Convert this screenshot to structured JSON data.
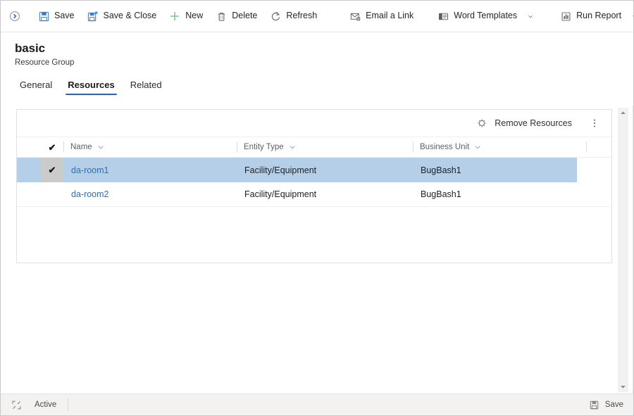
{
  "commandbar": {
    "back_icon": "chevron-right-circle-icon",
    "buttons": [
      {
        "id": "save",
        "label": "Save",
        "icon": "floppy-disk-icon",
        "caret": false
      },
      {
        "id": "save-and-close",
        "label": "Save & Close",
        "icon": "save-close-icon",
        "caret": false
      },
      {
        "id": "new",
        "label": "New",
        "icon": "plus-icon",
        "caret": false
      },
      {
        "id": "delete",
        "label": "Delete",
        "icon": "trash-icon",
        "caret": false
      },
      {
        "id": "refresh",
        "label": "Refresh",
        "icon": "refresh-icon",
        "caret": false
      },
      {
        "id": "email-a-link",
        "label": "Email a Link",
        "icon": "email-link-icon",
        "caret": false
      },
      {
        "id": "word-templates",
        "label": "Word Templates",
        "icon": "word-document-icon",
        "caret": true
      },
      {
        "id": "run-report",
        "label": "Run Report",
        "icon": "bar-chart-icon",
        "caret": true
      }
    ]
  },
  "header": {
    "title": "basic",
    "subtitle": "Resource Group"
  },
  "tabs": [
    {
      "id": "general",
      "label": "General",
      "active": false
    },
    {
      "id": "resources",
      "label": "Resources",
      "active": true
    },
    {
      "id": "related",
      "label": "Related",
      "active": false
    }
  ],
  "grid": {
    "commands": {
      "remove_resources_label": "Remove Resources",
      "remove_resources_icon": "remove-link-icon",
      "overflow_icon": "more-vertical-icon"
    },
    "select_all_icon": "checkmark-icon",
    "columns": [
      {
        "id": "name",
        "label": "Name",
        "sort_icon": "chevron-down-icon"
      },
      {
        "id": "entity-type",
        "label": "Entity Type",
        "sort_icon": "chevron-down-icon"
      },
      {
        "id": "business-unit",
        "label": "Business Unit",
        "sort_icon": "chevron-down-icon"
      }
    ],
    "rows": [
      {
        "selected": true,
        "check_icon": "checkmark-icon",
        "name": "da-room1",
        "entity_type": "Facility/Equipment",
        "business_unit": "BugBash1"
      },
      {
        "selected": false,
        "check_icon": "",
        "name": "da-room2",
        "entity_type": "Facility/Equipment",
        "business_unit": "BugBash1"
      }
    ]
  },
  "scrollbar": {
    "up_icon": "caret-up-icon",
    "down_icon": "caret-down-icon"
  },
  "statusbar": {
    "expand_icon": "expand-icon",
    "status_text": "Active",
    "save_label": "Save",
    "save_icon": "floppy-disk-icon"
  },
  "colors": {
    "accent": "#2266cc",
    "link": "#2a6fb8",
    "selected_row": "#b6cfe8",
    "save_icon_blue": "#3a79c4",
    "new_icon_green": "#7dc48d",
    "statusbar_bg": "#f3f2f1"
  }
}
